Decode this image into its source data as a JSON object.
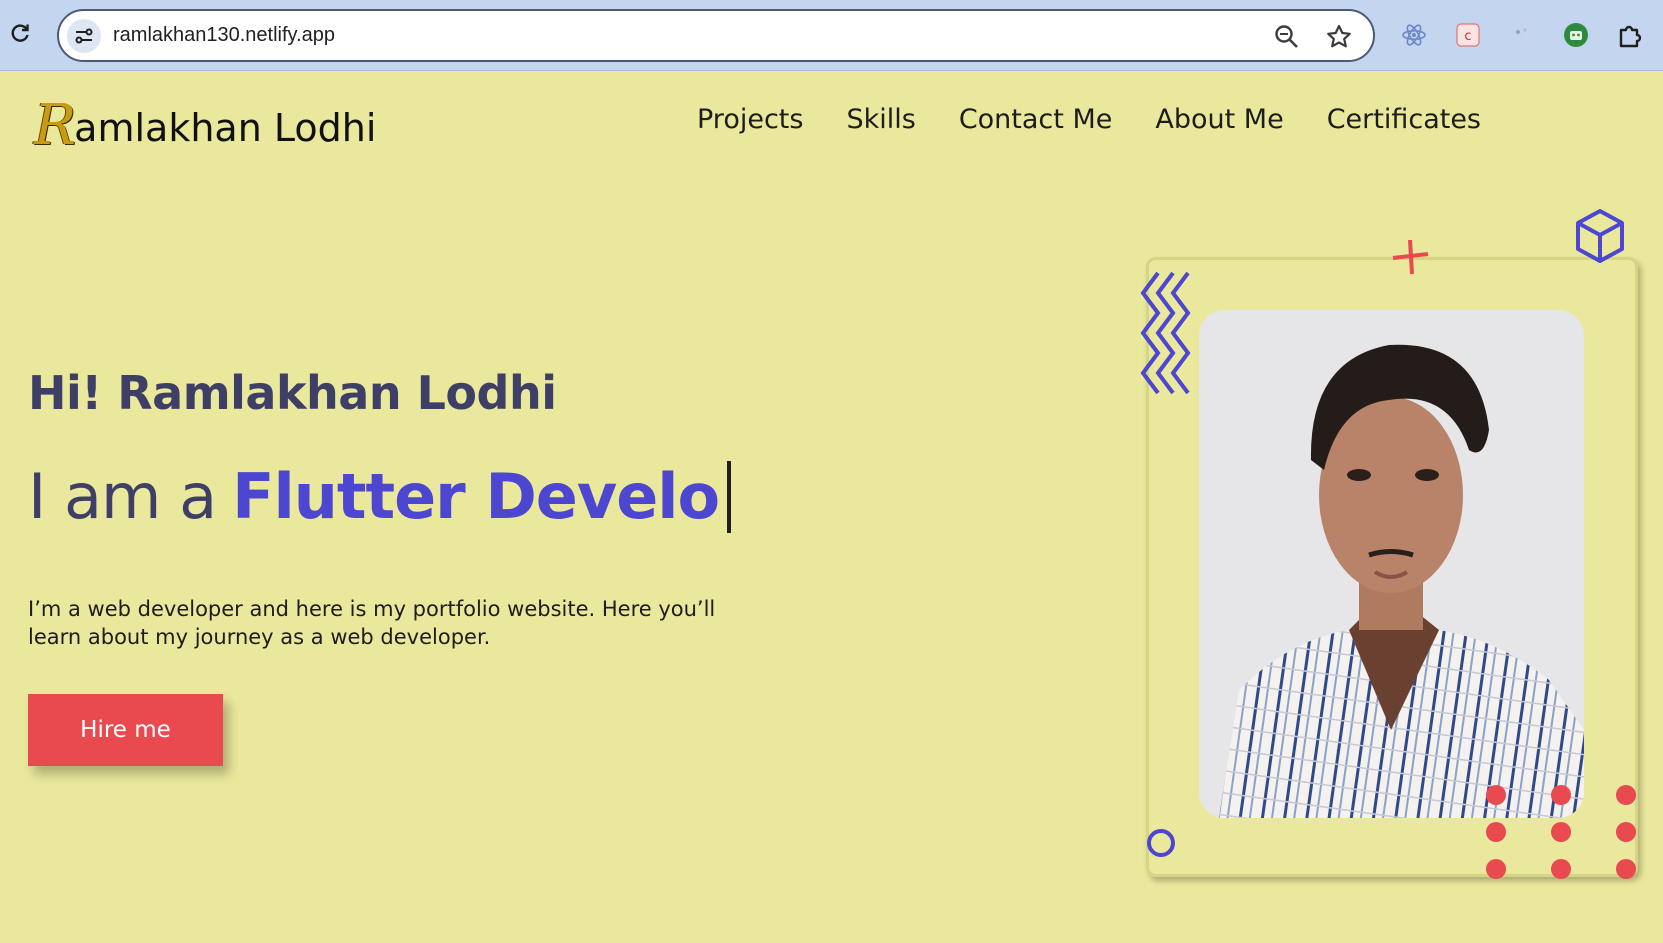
{
  "browser": {
    "url": "ramlakhan130.netlify.app",
    "icons": [
      "reload-icon",
      "site-info-icon",
      "zoom-icon",
      "bookmark-star-icon",
      "react-devtools-icon",
      "extension-red-icon",
      "extension-gray-icon",
      "extension-green-icon",
      "extensions-puzzle-icon"
    ]
  },
  "logo": {
    "initial": "R",
    "rest": "amlakhan Lodhi"
  },
  "nav": {
    "items": [
      "Projects",
      "Skills",
      "Contact Me",
      "About Me",
      "Certificates"
    ]
  },
  "hero": {
    "greeting": "Hi! Ramlakhan Lodhi",
    "role_prefix": "I am a",
    "role_typed": "Flutter Develo",
    "intro_line1": "I’m a web developer and here is my portfolio website. Here you’ll",
    "intro_line2": "learn about my journey as a web developer.",
    "hire_label": "Hire me"
  },
  "colors": {
    "page_background": "#e9e89c",
    "accent_blue": "#4c46d0",
    "accent_red": "#e84a4f",
    "text_dark": "#3d3f66"
  }
}
